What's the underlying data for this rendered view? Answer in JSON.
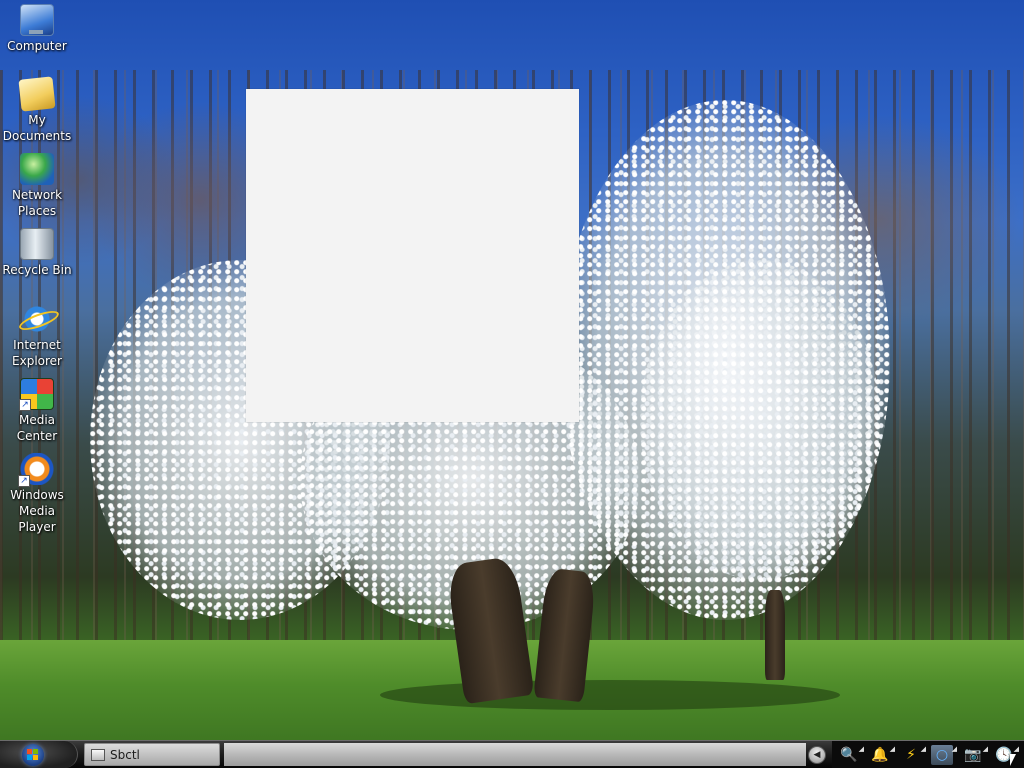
{
  "desktop": {
    "icons": [
      {
        "label": "Computer",
        "icon": "computer-icon"
      },
      {
        "label": "My Documents",
        "icon": "documents-folder-icon"
      },
      {
        "label": "Network Places",
        "icon": "network-icon"
      },
      {
        "label": "Recycle Bin",
        "icon": "recycle-bin-icon"
      },
      {
        "label": "Internet Explorer",
        "icon": "internet-explorer-icon"
      },
      {
        "label": "Media Center",
        "icon": "media-center-icon",
        "shortcut": true
      },
      {
        "label": "Windows Media Player",
        "icon": "media-player-icon",
        "shortcut": true
      }
    ]
  },
  "taskbar": {
    "start_icon": "windows-logo-icon",
    "tasks": [
      {
        "label": "Sbctl",
        "icon": "window-icon"
      }
    ],
    "tray_toggle_icon": "tray-chevron-icon",
    "tray_icons": [
      "search-icon",
      "bell-icon",
      "lightning-icon",
      "internet-explorer-icon",
      "camera-icon",
      "clock-icon"
    ]
  },
  "colors": {
    "taskbar": "#1b1b1b",
    "blank_window": "#f3f3f3",
    "sky": "#2e62c4",
    "grass": "#4f8c2a"
  }
}
